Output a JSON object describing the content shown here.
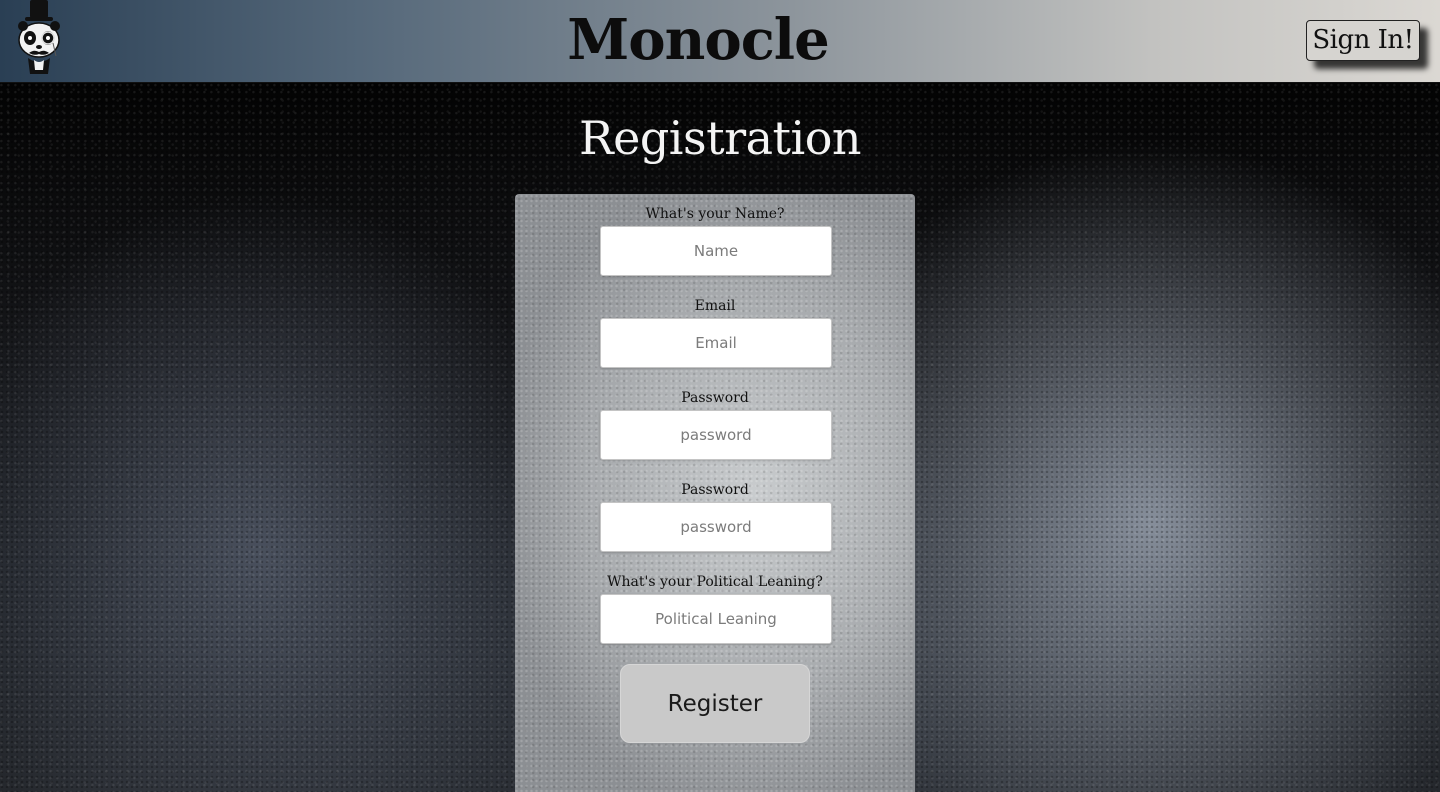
{
  "header": {
    "title": "Monocle",
    "signin_label": "Sign In!",
    "logo_icon": "panda-top-hat-monocle-icon"
  },
  "page": {
    "heading": "Registration"
  },
  "form": {
    "name": {
      "label": "What's your Name?",
      "placeholder": "Name",
      "value": ""
    },
    "email": {
      "label": "Email",
      "placeholder": "Email",
      "value": ""
    },
    "password": {
      "label": "Password",
      "placeholder": "password",
      "value": ""
    },
    "password_confirm": {
      "label": "Password",
      "placeholder": "password",
      "value": ""
    },
    "political": {
      "label": "What's your Political Leaning?",
      "placeholder": "Political Leaning",
      "value": ""
    },
    "submit_label": "Register"
  },
  "colors": {
    "header_gradient_start": "#2a3f54",
    "header_gradient_end": "#dbd8d3",
    "panel": "#b0b3b6",
    "button": "#c9c9c9"
  }
}
